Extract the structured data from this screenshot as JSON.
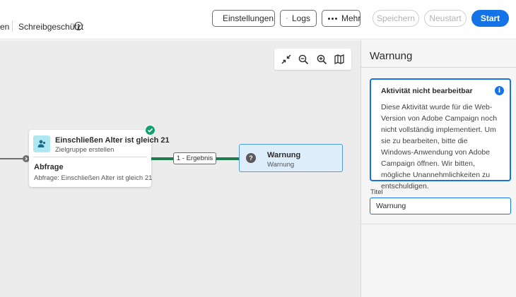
{
  "header": {
    "breadcrumb_cut": "en",
    "read_only": "Schreibgeschützt",
    "buttons": {
      "settings": "Einstellungen",
      "logs": "Logs",
      "more": "Mehr",
      "save": "Speichern",
      "restart": "Neustart",
      "start": "Start"
    }
  },
  "canvas": {
    "query_node": {
      "title": "Einschließen Alter ist gleich 21",
      "subtitle": "Zielgruppe erstellen",
      "type": "Abfrage",
      "detail": "Abfrage: Einschließen Alter ist gleich 21",
      "status": "success"
    },
    "edge_label": "1 - Ergebnis",
    "warning_node": {
      "title": "Warnung",
      "subtitle": "Warnung"
    }
  },
  "panel": {
    "title": "Warnung",
    "alert": {
      "title": "Aktivität nicht bearbeitbar",
      "body": "Diese Aktivität wurde für die Web-Version von Adobe Campaign noch nicht vollständig implementiert. Um sie zu bearbeiten, bitte die Windows-Anwendung von Adobe Campaign öffnen. Wir bitten, mögliche Unannehmlichkeiten zu entschuldigen."
    },
    "field": {
      "label": "Titel",
      "value": "Warnung"
    }
  },
  "colors": {
    "accent": "#1473e6",
    "success": "#12a06e",
    "edge": "#1d7c4d",
    "canvas": "#ececec"
  }
}
